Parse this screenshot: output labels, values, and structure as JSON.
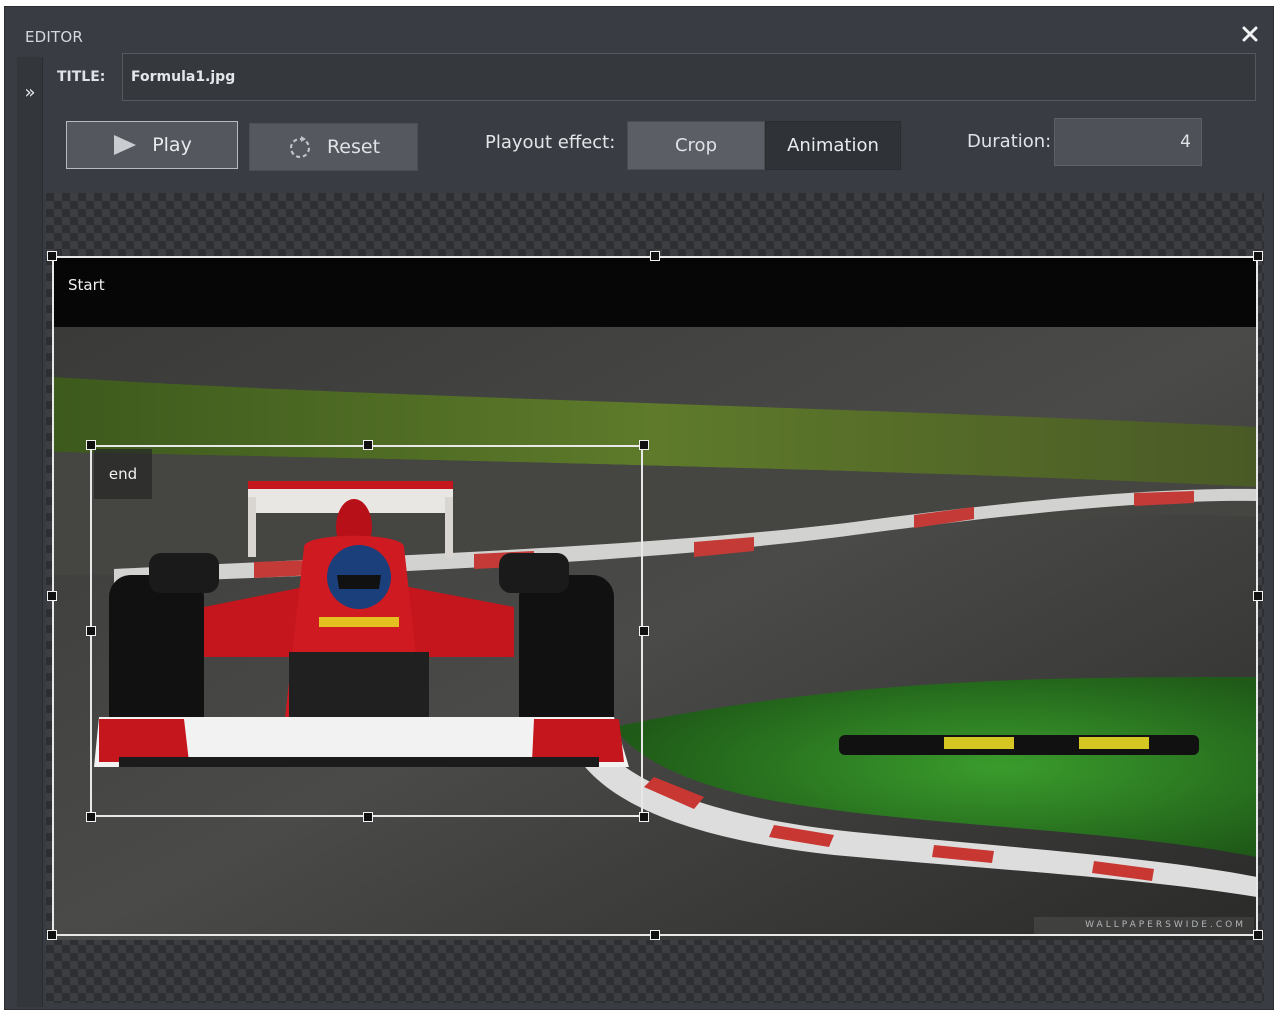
{
  "window": {
    "title": "EDITOR",
    "close_icon": "close-icon"
  },
  "sidebar": {
    "expand_glyph": "»",
    "expand_icon": "double-chevron-right-icon"
  },
  "title_field": {
    "label": "TITLE:",
    "value": "Formula1.jpg"
  },
  "toolbar": {
    "play_label": "Play",
    "play_icon": "play-icon",
    "reset_label": "Reset",
    "reset_icon": "reset-icon",
    "playout_effect_label": "Playout effect:",
    "effects": [
      "Crop",
      "Animation"
    ],
    "selected_effect": "Animation",
    "duration_label": "Duration:",
    "duration_value": "4"
  },
  "canvas": {
    "start_label": "Start",
    "end_label": "end",
    "watermark": "WALLPAPERSWIDE.COM",
    "image_subject": "formula-1-race-car-on-track"
  },
  "colors": {
    "panel_bg": "#393c42",
    "selected_segment": "#2f3236",
    "unselected_segment": "#5b5e64",
    "car_red": "#c4161c"
  }
}
